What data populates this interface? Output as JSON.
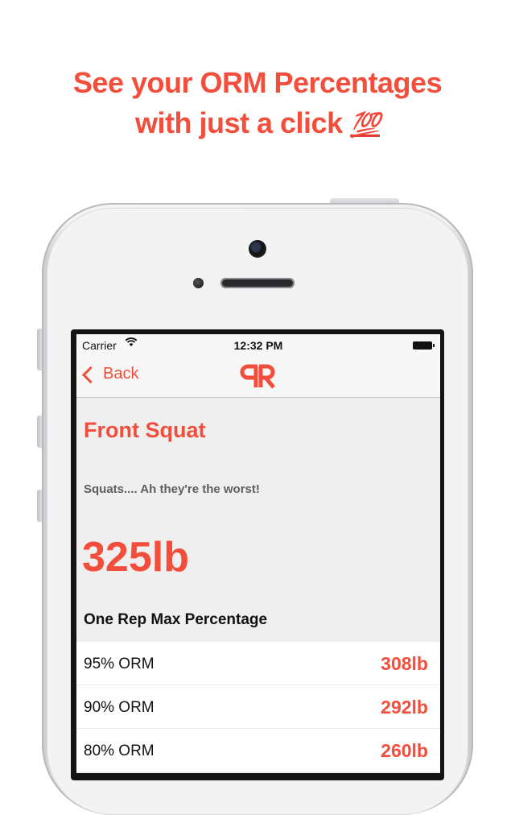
{
  "headline": {
    "line1": "See your ORM Percentages",
    "line2": "with just a click",
    "emoji": "💯"
  },
  "status_bar": {
    "carrier": "Carrier",
    "wifi_icon": "wifi-icon",
    "time": "12:32 PM",
    "battery_icon": "battery-icon"
  },
  "nav": {
    "back_label": "Back",
    "logo_text": "RR"
  },
  "exercise": {
    "title": "Front Squat",
    "description": "Squats.... Ah they're the worst!",
    "max_weight": "325lb"
  },
  "section_title": "One Rep Max Percentage",
  "percentages": [
    {
      "label": "95% ORM",
      "value": "308lb"
    },
    {
      "label": "90% ORM",
      "value": "292lb"
    },
    {
      "label": "80% ORM",
      "value": "260lb"
    }
  ],
  "colors": {
    "accent": "#f24e3b"
  }
}
